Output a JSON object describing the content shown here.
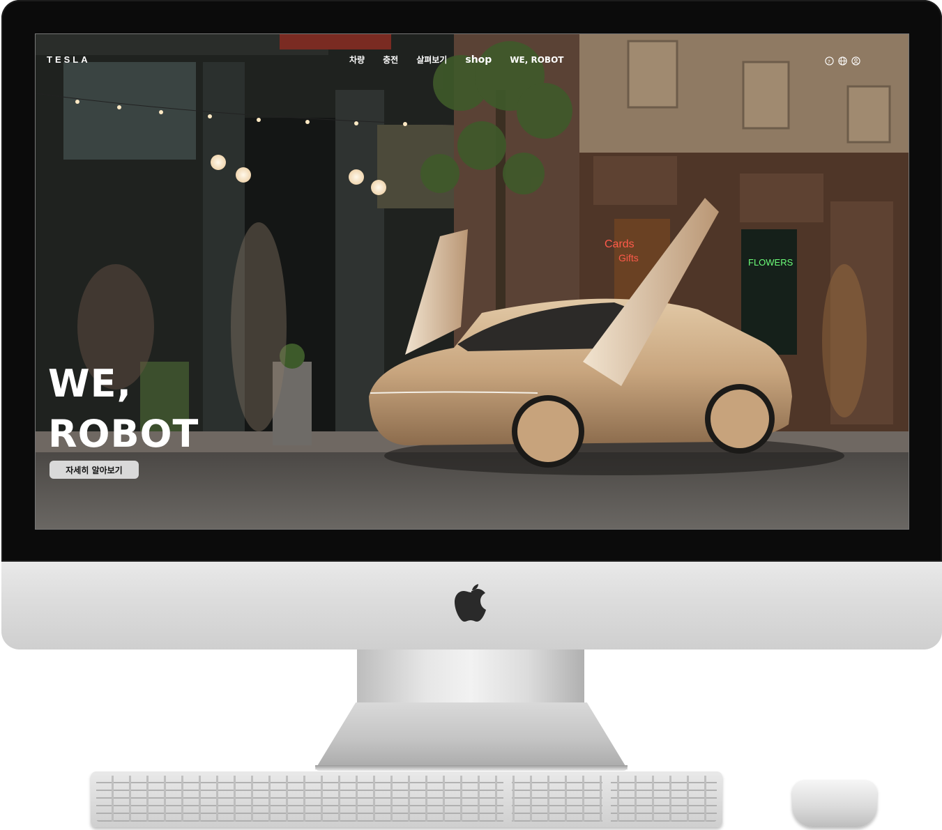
{
  "site": {
    "brand": "TESLA",
    "nav": [
      {
        "label": "차량"
      },
      {
        "label": "충전"
      },
      {
        "label": "살펴보기"
      },
      {
        "label": "shop"
      },
      {
        "label": "WE, ROBOT"
      }
    ],
    "icons": [
      "help-icon",
      "globe-icon",
      "account-icon"
    ]
  },
  "hero": {
    "title_line1": "WE,",
    "title_line2": "ROBOT",
    "cta_label": "자세히 알아보기"
  },
  "scene": {
    "sign_cards": "Cards",
    "sign_gifts": "Gifts",
    "sign_flowers": "FLOWERS"
  },
  "colors": {
    "car_body": "#c8a57e",
    "bezel": "#0b0b0b",
    "cta_bg": "#d9d9d9",
    "neon_red": "#ff5a4a",
    "neon_green": "#6dff7a"
  }
}
